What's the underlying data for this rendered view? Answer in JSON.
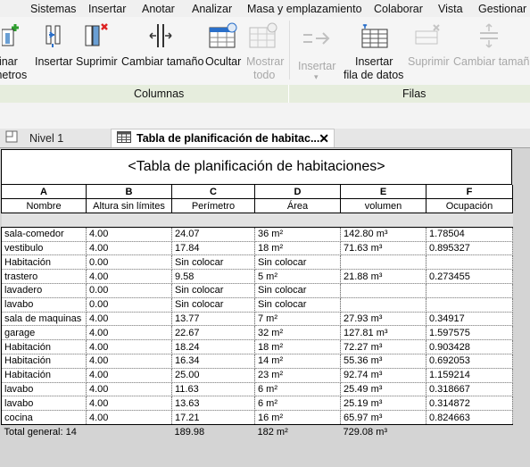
{
  "menu": [
    "Sistemas",
    "Insertar",
    "Anotar",
    "Analizar",
    "Masa y emplazamiento",
    "Colaborar",
    "Vista",
    "Gestionar"
  ],
  "ribbon": {
    "buttons": [
      {
        "line1": "binar",
        "line2": "metros",
        "icon": "combine-parameters-icon",
        "disabled": false
      },
      {
        "line1": "Insertar",
        "line2": "",
        "icon": "insert-column-icon",
        "disabled": false
      },
      {
        "line1": "Suprimir",
        "line2": "",
        "icon": "delete-column-icon",
        "disabled": false
      },
      {
        "line1": "Cambiar tamaño",
        "line2": "",
        "icon": "resize-column-icon",
        "disabled": false
      },
      {
        "line1": "Ocultar",
        "line2": "",
        "icon": "hide-column-icon",
        "disabled": false
      },
      {
        "line1": "Mostrar",
        "line2": "todo",
        "icon": "unhide-all-icon",
        "disabled": true
      },
      {
        "line1": "Insertar",
        "line2": "",
        "icon": "insert-row-icon",
        "disabled": true
      },
      {
        "line1": "Insertar",
        "line2": "fila de datos",
        "icon": "insert-data-row-icon",
        "disabled": false
      },
      {
        "line1": "Suprimir",
        "line2": "",
        "icon": "delete-row-icon",
        "disabled": true
      },
      {
        "line1": "Cambiar tamaño",
        "line2": "",
        "icon": "resize-row-icon",
        "disabled": true
      }
    ],
    "groups": [
      "Columnas",
      "Filas"
    ]
  },
  "tabs": {
    "inactive": "Nivel 1",
    "active": "Tabla de planificación de habitac...",
    "close_glyph": "✕"
  },
  "schedule": {
    "title": "<Tabla de planificación de habitaciones>",
    "letters": [
      "A",
      "B",
      "C",
      "D",
      "E",
      "F"
    ],
    "headers": [
      "Nombre",
      "Altura sin límites",
      "Perímetro",
      "Área",
      "volumen",
      "Ocupación"
    ],
    "rows": [
      [
        "sala-comedor",
        "4.00",
        "24.07",
        "36 m²",
        "142.80 m³",
        "1.78504"
      ],
      [
        "vestibulo",
        "4.00",
        "17.84",
        "18 m²",
        "71.63 m³",
        "0.895327"
      ],
      [
        "Habitación",
        "0.00",
        "Sin colocar",
        "Sin colocar",
        "",
        ""
      ],
      [
        "trastero",
        "4.00",
        "9.58",
        "5 m²",
        "21.88 m³",
        "0.273455"
      ],
      [
        "lavadero",
        "0.00",
        "Sin colocar",
        "Sin colocar",
        "",
        ""
      ],
      [
        "lavabo",
        "0.00",
        "Sin colocar",
        "Sin colocar",
        "",
        ""
      ],
      [
        "sala de maquinas",
        "4.00",
        "13.77",
        "7 m²",
        "27.93 m³",
        "0.34917"
      ],
      [
        "garage",
        "4.00",
        "22.67",
        "32 m²",
        "127.81 m³",
        "1.597575"
      ],
      [
        "Habitación",
        "4.00",
        "18.24",
        "18 m²",
        "72.27 m³",
        "0.903428"
      ],
      [
        "Habitación",
        "4.00",
        "16.34",
        "14 m²",
        "55.36 m³",
        "0.692053"
      ],
      [
        "Habitación",
        "4.00",
        "25.00",
        "23 m²",
        "92.74 m³",
        "1.159214"
      ],
      [
        "lavabo",
        "4.00",
        "11.63",
        "6 m²",
        "25.49 m³",
        "0.318667"
      ],
      [
        "lavabo",
        "4.00",
        "13.63",
        "6 m²",
        "25.19 m³",
        "0.314872"
      ],
      [
        "cocina",
        "4.00",
        "17.21",
        "16 m²",
        "65.97 m³",
        "0.824663"
      ]
    ],
    "total": [
      "Total general: 14",
      "",
      "189.98",
      "182 m²",
      "729.08 m³",
      ""
    ]
  }
}
